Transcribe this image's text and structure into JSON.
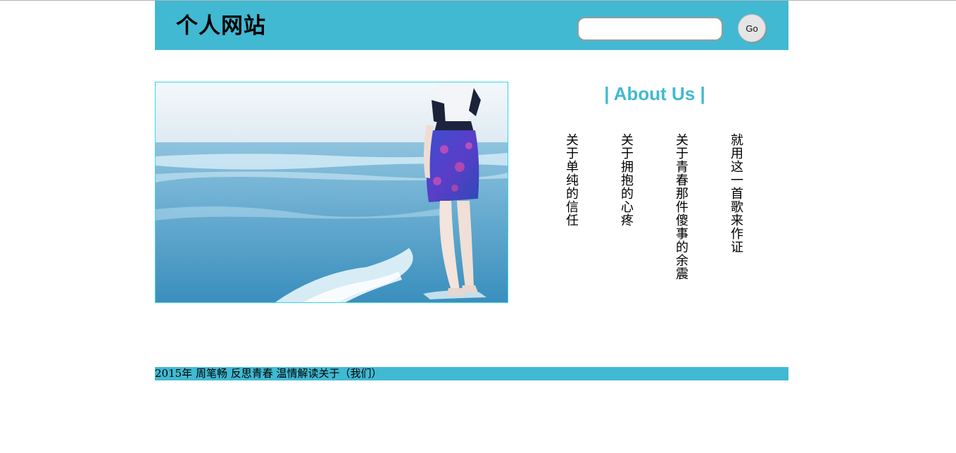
{
  "header": {
    "title": "个人网站",
    "search_placeholder": "",
    "go_label": "Go"
  },
  "photo": {
    "alt": "Girl standing in sea waves on the beach"
  },
  "about": {
    "title": "| About Us |",
    "lyrics": [
      "关于单纯的信任",
      "关于拥抱的心疼",
      "关于青春那件傻事的余震",
      "就用这一首歌来作证"
    ]
  },
  "footer": {
    "text": "2015年 周笔畅 反思青春 温情解读关于（我们）"
  },
  "colors": {
    "accent": "#41b9d2",
    "photo_border": "#33d6ee"
  }
}
